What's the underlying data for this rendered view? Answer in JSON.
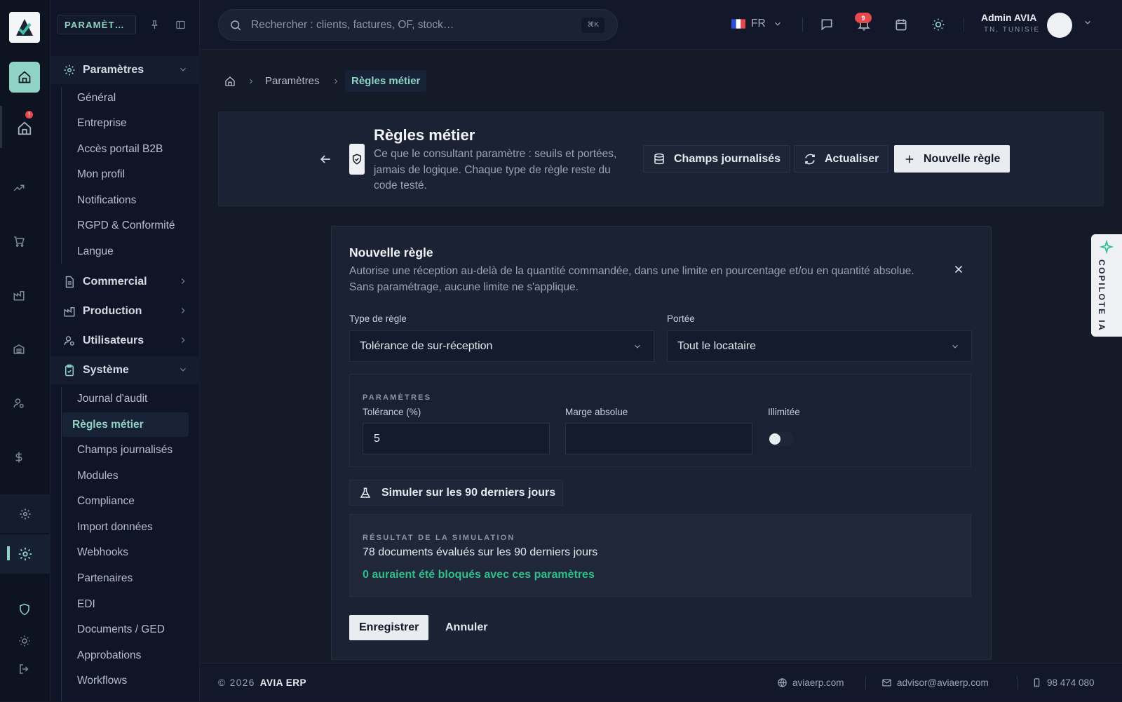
{
  "sidebar": {
    "chip": "PARAMÈT…",
    "sections": {
      "parametres": {
        "label": "Paramètres",
        "items": [
          "Général",
          "Entreprise",
          "Accès portail B2B",
          "Mon profil",
          "Notifications",
          "RGPD & Conformité",
          "Langue"
        ]
      },
      "commercial": {
        "label": "Commercial"
      },
      "production": {
        "label": "Production"
      },
      "utilisateurs": {
        "label": "Utilisateurs"
      },
      "systeme": {
        "label": "Système",
        "items": [
          "Journal d'audit",
          "Règles métier",
          "Champs journalisés",
          "Modules",
          "Compliance",
          "Import données",
          "Webhooks",
          "Partenaires",
          "EDI",
          "Documents / GED",
          "Approbations",
          "Workflows"
        ]
      }
    }
  },
  "topbar": {
    "search_placeholder": "Rechercher : clients, factures, OF, stock…",
    "search_shortcut": "⌘K",
    "language": "FR",
    "notifications_count": "9",
    "user_name": "Admin AVIA",
    "user_location": "TN, TUNISIE"
  },
  "breadcrumb": {
    "parent": "Paramètres",
    "current": "Règles métier"
  },
  "header": {
    "title": "Règles métier",
    "description": "Ce que le consultant paramètre : seuils et portées, jamais de logique. Chaque type de règle reste du code testé.",
    "btn_fields": "Champs journalisés",
    "btn_refresh": "Actualiser",
    "btn_new": "Nouvelle règle"
  },
  "form": {
    "title": "Nouvelle règle",
    "description": "Autorise une réception au-delà de la quantité commandée, dans une limite en pourcentage et/ou en quantité absolue. Sans paramétrage, aucune limite ne s'applique.",
    "rule_type_label": "Type de règle",
    "rule_type_value": "Tolérance de sur-réception",
    "scope_label": "Portée",
    "scope_value": "Tout le locataire",
    "params_caption": "PARAMÈTRES",
    "tolerance_label": "Tolérance (%)",
    "tolerance_value": "5",
    "margin_label": "Marge absolue",
    "margin_value": "",
    "unlimited_label": "Illimitée",
    "unlimited_on": false,
    "simulate_label": "Simuler sur les 90 derniers jours",
    "result_caption": "RÉSULTAT DE LA SIMULATION",
    "result_line": "78 documents évalués sur les 90 derniers jours",
    "result_blocked": "0 auraient été bloqués avec ces paramètres",
    "save_label": "Enregistrer",
    "cancel_label": "Annuler"
  },
  "footer": {
    "copyright": "© 2026",
    "brand": "AVIA ERP",
    "website": "aviaerp.com",
    "email": "advisor@aviaerp.com",
    "phone": "98 474 080"
  },
  "copilot": {
    "label": "COPILOTE IA"
  },
  "colors": {
    "accent": "#8fd3c4",
    "success": "#2fbf8a",
    "danger": "#e5484d",
    "background": "#141a27"
  }
}
